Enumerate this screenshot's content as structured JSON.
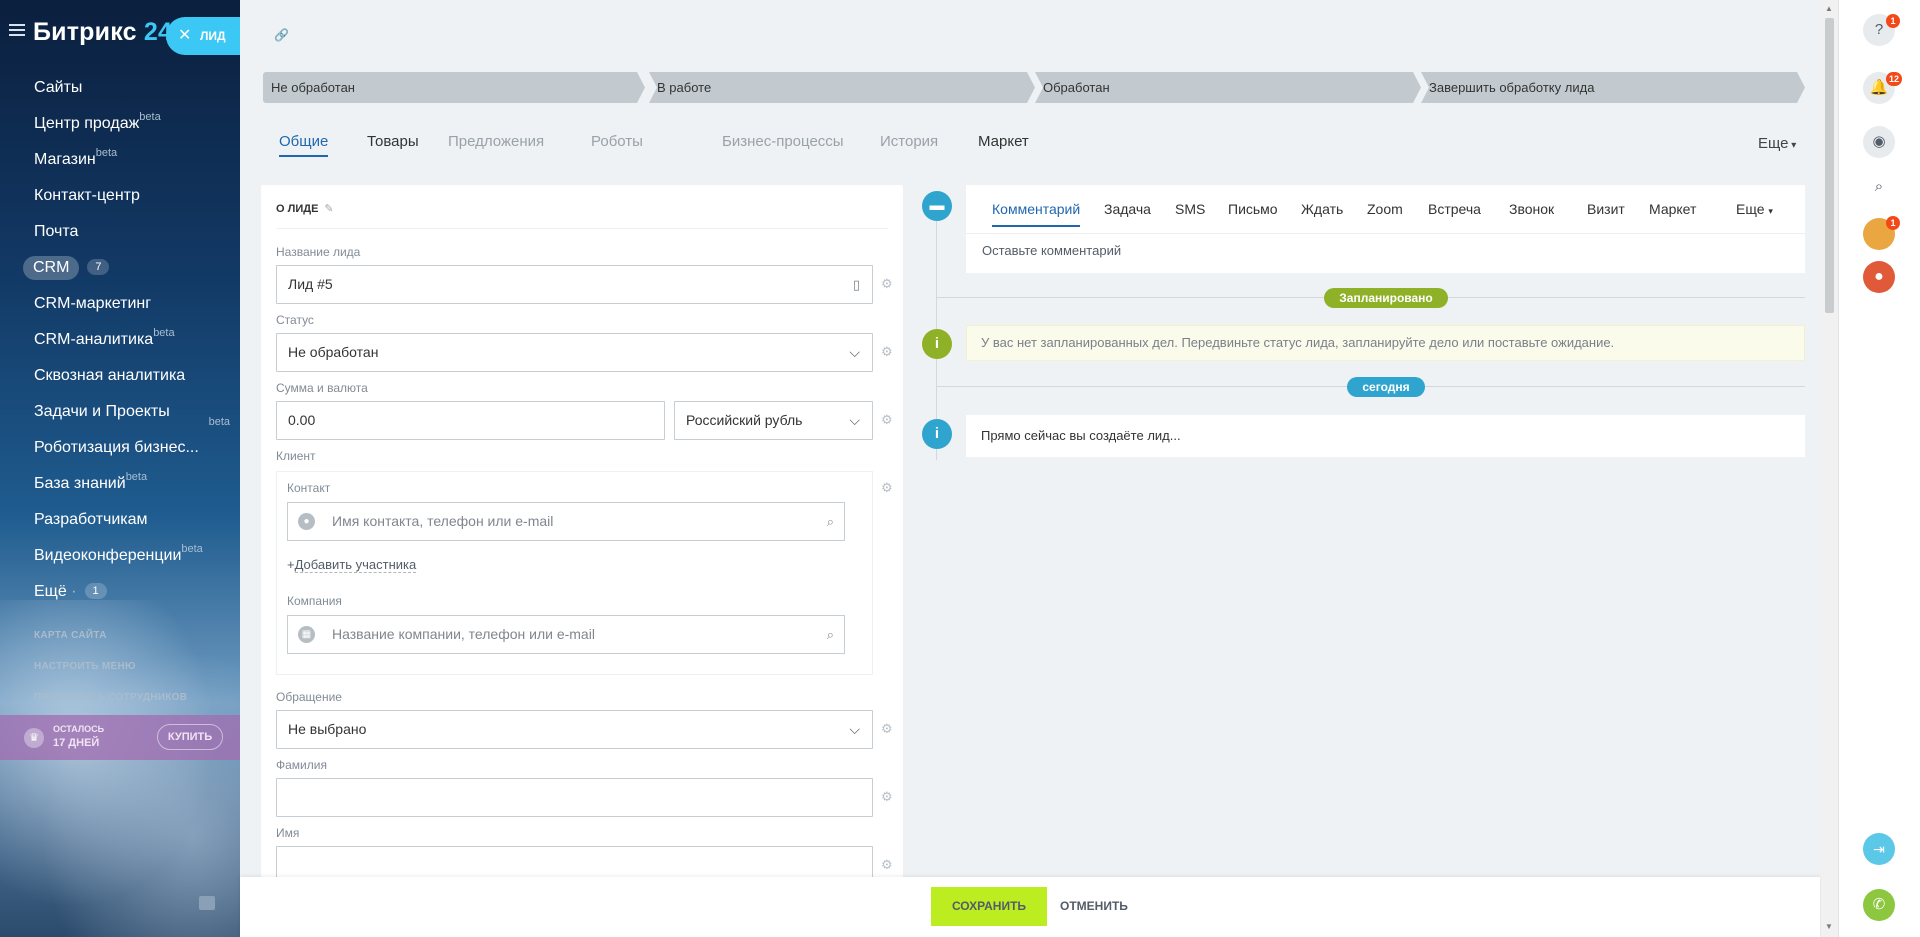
{
  "sidebar": {
    "logo": "Битрикс",
    "logo_num": "24",
    "items": [
      {
        "label": "Сайты",
        "sup": ""
      },
      {
        "label": "Центр продаж",
        "sup": "beta"
      },
      {
        "label": "Магазин",
        "sup": "beta"
      },
      {
        "label": "Контакт-центр",
        "sup": ""
      },
      {
        "label": "Почта",
        "sup": ""
      },
      {
        "label": "CRM",
        "sup": "",
        "badge": "7"
      },
      {
        "label": "CRM-маркетинг",
        "sup": ""
      },
      {
        "label": "CRM-аналитика",
        "sup": "beta"
      },
      {
        "label": "Сквозная аналитика",
        "sup": ""
      },
      {
        "label": "Задачи и Проекты",
        "sup": ""
      },
      {
        "label": "Роботизация бизнес...",
        "sup": "beta"
      },
      {
        "label": "База знаний",
        "sup": "beta"
      },
      {
        "label": "Разработчикам",
        "sup": ""
      },
      {
        "label": "Видеоконференции",
        "sup": "beta"
      },
      {
        "label": "Ещё",
        "sup": "",
        "badge": "1"
      }
    ],
    "service_links": [
      "КАРТА САЙТА",
      "НАСТРОИТЬ МЕНЮ",
      "ПРИГЛАСИТЬ СОТРУДНИКОВ"
    ],
    "trial": {
      "line1": "ОСТАЛОСЬ",
      "line2": "17 ДНЕЙ",
      "buy": "КУПИТЬ"
    }
  },
  "lead_tag": {
    "label": "ЛИД",
    "close": "✕"
  },
  "stages": [
    "Не обработан",
    "В работе",
    "Обработан",
    "Завершить обработку лида"
  ],
  "tabs": [
    {
      "label": "Общие",
      "state": "active"
    },
    {
      "label": "Товары",
      "state": "normal"
    },
    {
      "label": "Предложения",
      "state": "dim"
    },
    {
      "label": "Роботы",
      "state": "dim"
    },
    {
      "label": "Бизнес-процессы",
      "state": "dim"
    },
    {
      "label": "История",
      "state": "dim"
    },
    {
      "label": "Маркет",
      "state": "normal"
    }
  ],
  "tabs_more": "Еще",
  "form": {
    "title": "О ЛИДЕ",
    "name_label": "Название лида",
    "name_value": "Лид #5",
    "status_label": "Статус",
    "status_value": "Не обработан",
    "sum_label": "Сумма и валюта",
    "sum_value": "0.00",
    "currency_value": "Российский рубль",
    "client_label": "Клиент",
    "contact_label": "Контакт",
    "contact_placeholder": "Имя контакта, телефон или e-mail",
    "add_participant": "Добавить участника",
    "company_label": "Компания",
    "company_placeholder": "Название компании, телефон или e-mail",
    "salutation_label": "Обращение",
    "salutation_value": "Не выбрано",
    "lastname_label": "Фамилия",
    "lastname_value": "",
    "firstname_label": "Имя",
    "firstname_value": ""
  },
  "activity": {
    "tabs": [
      "Комментарий",
      "Задача",
      "SMS",
      "Письмо",
      "Ждать",
      "Zoom",
      "Встреча",
      "Звонок",
      "Визит",
      "Маркет"
    ],
    "more": "Еще",
    "comment_placeholder": "Оставьте комментарий"
  },
  "timeline": {
    "planned_label": "Запланировано",
    "planned_notice": "У вас нет запланированных дел. Передвиньте статус лида, запланируйте дело или поставьте ожидание.",
    "today_label": "сегодня",
    "now_text": "Прямо сейчас вы создаёте лид..."
  },
  "buttons": {
    "save": "СОХРАНИТЬ",
    "cancel": "ОТМЕНИТЬ"
  },
  "right_panel": {
    "help_badge": "1",
    "notif_badge": "12",
    "avatar_badge": "1"
  },
  "colors": {
    "accent": "#2067b0",
    "save_button": "#bbed21",
    "lead_tag": "#3bc8f5",
    "planned": "#8fb128",
    "today": "#2fa4cf"
  }
}
